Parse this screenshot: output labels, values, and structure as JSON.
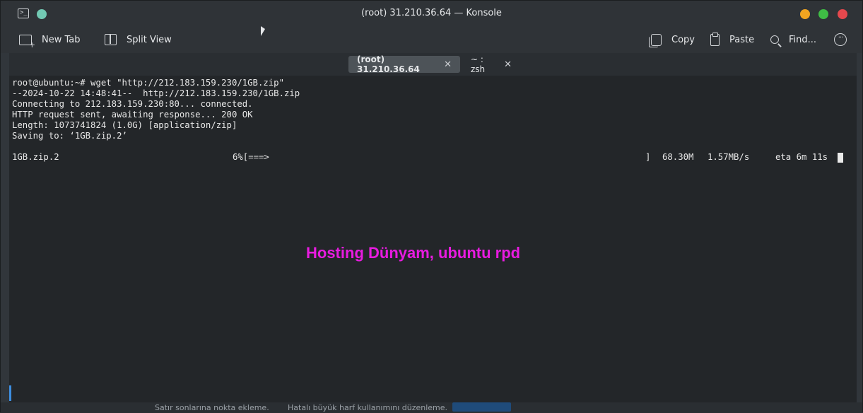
{
  "window": {
    "title": "(root) 31.210.36.64 — Konsole"
  },
  "toolbar": {
    "new_tab": "New Tab",
    "split_view": "Split View",
    "copy": "Copy",
    "paste": "Paste",
    "find": "Find..."
  },
  "tabs": [
    {
      "label": "(root) 31.210.36.64",
      "close": "✕"
    },
    {
      "label": "~ : zsh",
      "close": "✕"
    }
  ],
  "terminal": {
    "lines": [
      "root@ubuntu:~# wget \"http://212.183.159.230/1GB.zip\"",
      "--2024-10-22 14:48:41--  http://212.183.159.230/1GB.zip",
      "Connecting to 212.183.159.230:80... connected.",
      "HTTP request sent, awaiting response... 200 OK",
      "Length: 1073741824 (1.0G) [application/zip]",
      "Saving to: ‘1GB.zip.2’"
    ],
    "progress": {
      "filename": "1GB.zip.2",
      "percent": "6%[===>",
      "bar_end": "]",
      "downloaded": "68.30M",
      "speed": "1.57MB/s",
      "eta": "eta 6m 11s"
    }
  },
  "watermark": "Hosting Dünyam, ubuntu rpd",
  "background_app": {
    "text1": "Satır sonlarına nokta ekleme.",
    "text2": "Hatalı büyük harf kullanımını düzenleme."
  }
}
